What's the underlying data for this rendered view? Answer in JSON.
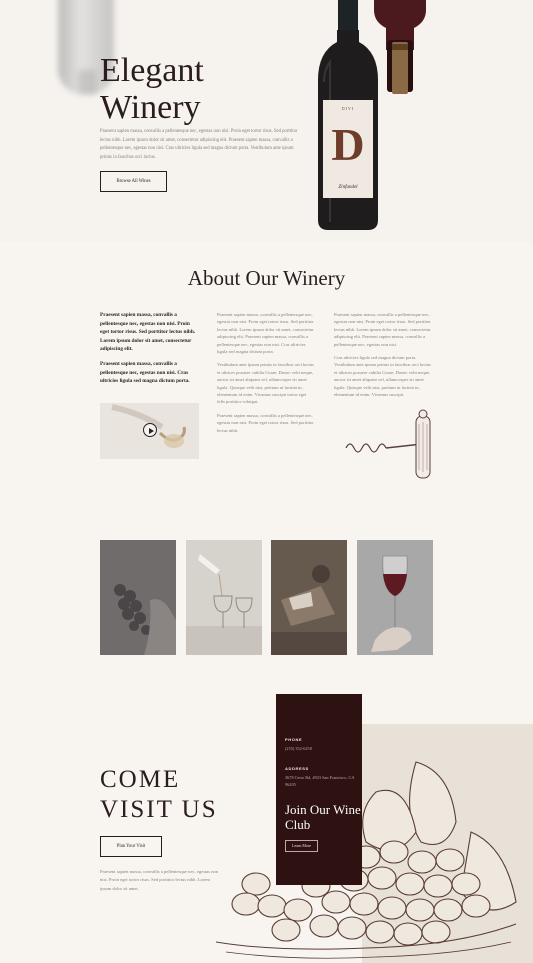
{
  "hero": {
    "title_line1": "Elegant",
    "title_line2": "Winery",
    "text": "Praesent sapien massa, convallis a pellentesque nec, egestas non nisi. Proin eget tortor risus. Sed porttitor lectus nibh. Lorem ipsum dolor sit amet, consectetur adipiscing elit. Praesent sapien massa, convallis a pellentesque nec, egestas non nisi. Cras ultricies ligula sed magna dictum porta. Vestibulum ante ipsum primis in faucibus orci luctus.",
    "button_label": "Browse All Wines",
    "bottle_label": {
      "top": "DIVI",
      "letter": "D",
      "name": "Zinfandel"
    }
  },
  "about": {
    "title": "About Our Winery",
    "col1": [
      "Praesent sapien massa, convallis a pellentesque nec, egestas non nisi. Proin eget tortor risus. Sed porttitor lectus nibh. Lorem ipsum dolor sit amet, consectetur adipiscing elit.",
      "Praesent sapien massa, convallis a pellentesque nec, egestas non nisi. Cras ultricies ligula sed magna dictum porta."
    ],
    "col2": [
      "Praesent sapien massa, convallis a pellentesque nec, egestas non nisi. Proin eget tortor risus. Sed porttitor lectus nibh. Lorem ipsum dolor sit amet, consectetur adipiscing elit. Praesent sapien massa, convallis a pellentesque nec, egestas non nisi. Cras ultricies ligula sed magna dictum porta.",
      "Vestibulum ante ipsum primis in faucibus orci luctus et ultrices posuere cubilia Curae; Donec velit neque, auctor sit amet aliquam vel, ullamcorper sit amet ligula. Quisque velit nisi, pretium ut lacinia in, elementum id enim. Vivamus suscipit tortor eget felis porttitor volutpat.",
      "Praesent sapien massa, convallis a pellentesque nec, egestas non nisi. Proin eget tortor risus. Sed porttitor lectus nibh."
    ],
    "col3": [
      "Praesent sapien massa, convallis a pellentesque nec, egestas non nisi. Proin eget tortor risus. Sed porttitor lectus nibh. Lorem ipsum dolor sit amet, consectetur adipiscing elit. Praesent sapien massa, convallis a pellentesque nec, egestas non nisi.",
      "Cras ultricies ligula sed magna dictum porta. Vestibulum ante ipsum primis in faucibus orci luctus et ultrices posuere cubilia Curae; Donec velit neque, auctor sit amet aliquam vel, ullamcorper sit amet ligula. Quisque velit nisi, pretium ut lacinia in, elementum id enim. Vivamus suscipit."
    ]
  },
  "visit": {
    "title_line1": "COME",
    "title_line2": "VISIT US",
    "button_label": "Plan Your Visit",
    "text": "Praesent sapien massa, convallis a pellentesque nec, egestas non nisi. Proin eget tortor risus. Sed porttitor lectus nibh. Lorem ipsum dolor sit amet."
  },
  "club": {
    "phone_label": "PHONE",
    "phone": "(255) 352-6258",
    "address_label": "ADDRESS",
    "address": "3678 Cetro Rd, #923 San Francisco, CA 96205",
    "title": "Join Our Wine Club",
    "button_label": "Learn More"
  },
  "colors": {
    "accent_dark": "#2e1111",
    "background": "#f8f5f1",
    "text": "#2b1d1d"
  }
}
